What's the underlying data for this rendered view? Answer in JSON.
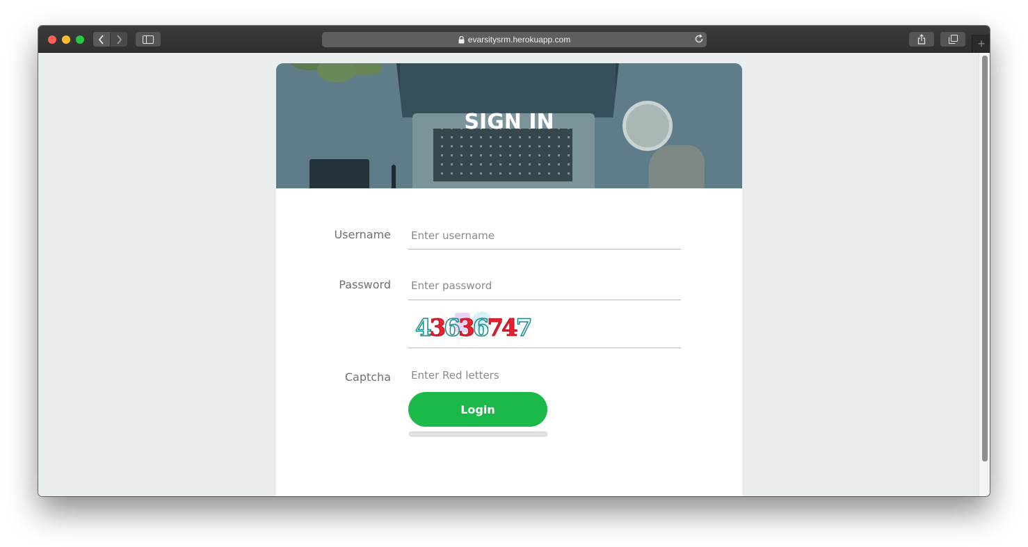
{
  "browser": {
    "url": "evarsitysrm.herokuapp.com",
    "icons": {
      "back": "chevron-left-icon",
      "forward": "chevron-right-icon",
      "sidebar": "sidebar-icon",
      "lock": "lock-icon",
      "reload": "reload-icon",
      "share": "share-icon",
      "tabs": "tabs-icon",
      "new_tab": "plus-icon"
    },
    "new_tab_label": "+"
  },
  "signin": {
    "title": "SIGN IN",
    "username_label": "Username",
    "username_placeholder": "Enter username",
    "password_label": "Password",
    "password_placeholder": "Enter password",
    "captcha_label": "Captcha",
    "captcha_placeholder": "Enter Red letters",
    "captcha_text": "43636747",
    "login_label": "Login",
    "progress": 0
  },
  "colors": {
    "accent": "#1bb84a",
    "hero_overlay": "#5e7d88",
    "captcha_red": "#e52230",
    "captcha_teal": "#1a8a8a"
  }
}
